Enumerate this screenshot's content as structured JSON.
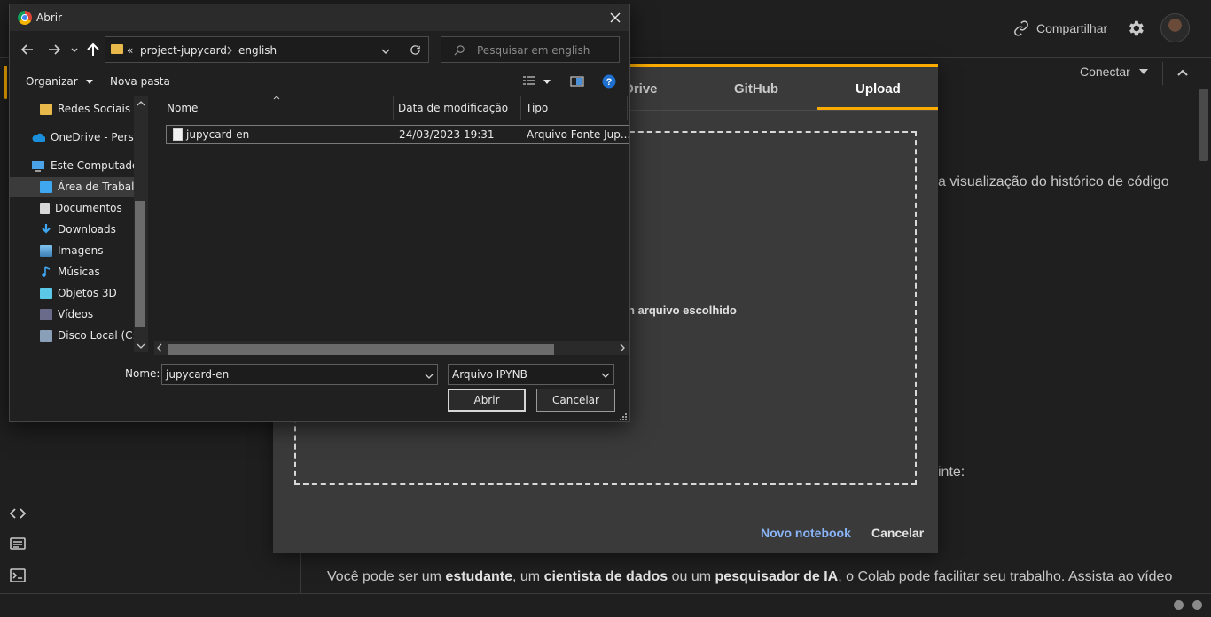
{
  "colab": {
    "share_label": "Compartilhar",
    "connect_label": "Conectar",
    "bg_text_history": "a visualização do histórico de código",
    "bg_text_below": "inte:",
    "intro": {
      "p1": "Você pode ser um ",
      "b1": "estudante",
      "p2": ", um ",
      "b2": "cientista de dados",
      "p3": " ou um ",
      "b3": "pesquisador de IA",
      "p4": ", o Colab pode facilitar seu trabalho. Assista ao vídeo"
    }
  },
  "open_dialog": {
    "tabs": [
      {
        "label": "Drive"
      },
      {
        "label": "GitHub"
      },
      {
        "label": "Upload"
      }
    ],
    "active_tab": "Upload",
    "file_status": "n arquivo escolhido",
    "new_notebook_label": "Novo notebook",
    "cancel_label": "Cancelar",
    "accent": "#f9ab00",
    "link_color": "#8ab4f8"
  },
  "file_dialog": {
    "title": "Abrir",
    "address": {
      "prefix": "«",
      "parts": [
        "project-jupycard",
        "english"
      ]
    },
    "search_placeholder": "Pesquisar em english",
    "toolbar": {
      "organize_label": "Organizar",
      "new_folder_label": "Nova pasta"
    },
    "tree": [
      {
        "label": "Redes Sociais",
        "icon": "folder-icon"
      },
      {
        "label": "OneDrive - Persor",
        "icon": "onedrive-icon"
      },
      {
        "label": "Este Computador",
        "icon": "computer-icon"
      },
      {
        "label": "Área de Trabalho",
        "icon": "desktop-icon",
        "selected": true
      },
      {
        "label": "Documentos",
        "icon": "documents-icon"
      },
      {
        "label": "Downloads",
        "icon": "downloads-icon"
      },
      {
        "label": "Imagens",
        "icon": "images-icon"
      },
      {
        "label": "Músicas",
        "icon": "music-icon"
      },
      {
        "label": "Objetos 3D",
        "icon": "objects-3d-icon"
      },
      {
        "label": "Vídeos",
        "icon": "videos-icon"
      },
      {
        "label": "Disco Local (C:)",
        "icon": "drive-icon"
      }
    ],
    "columns": [
      "Nome",
      "Data de modificação",
      "Tipo"
    ],
    "files": [
      {
        "name": "jupycard-en",
        "modified": "24/03/2023 19:31",
        "type": "Arquivo Fonte Jup..."
      }
    ],
    "name_label": "Nome:",
    "name_value": "jupycard-en",
    "filetype_value": "Arquivo IPYNB",
    "open_label": "Abrir",
    "cancel_label": "Cancelar"
  }
}
